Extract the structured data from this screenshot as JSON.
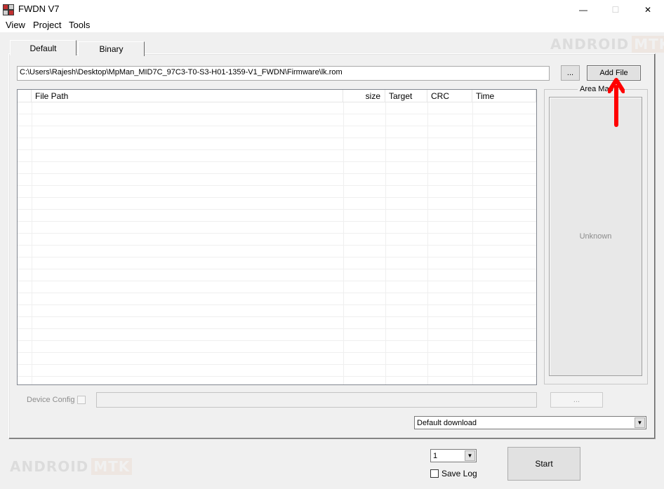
{
  "window": {
    "title": "FWDN V7",
    "controls": {
      "minimize": "—",
      "maximize": "☐",
      "close": "✕"
    }
  },
  "menu": [
    "View",
    "Project",
    "Tools"
  ],
  "tabs": [
    {
      "label": "Default",
      "active": true
    },
    {
      "label": "Binary",
      "active": false
    }
  ],
  "path_input": {
    "value": "C:\\Users\\Rajesh\\Desktop\\MpMan_MID7C_97C3-T0-S3-H01-1359-V1_FWDN\\Firmware\\lk.rom"
  },
  "buttons": {
    "browse": "...",
    "add_file": "Add File",
    "device_config_browse": "...",
    "start": "Start"
  },
  "file_table": {
    "columns": [
      "",
      "File Path",
      "size",
      "Target",
      "CRC",
      "Time"
    ],
    "rows": []
  },
  "area_map": {
    "label": "Area Map",
    "status": "Unknown"
  },
  "device_config": {
    "label": "Device Config",
    "checked": false,
    "enabled": false
  },
  "download_mode": {
    "selected": "Default download"
  },
  "count_select": {
    "selected": "1"
  },
  "save_log": {
    "label": "Save Log",
    "checked": false
  },
  "watermark": {
    "word1": "ANDROID",
    "word2": "MTK"
  },
  "colors": {
    "annotation_arrow": "#ff0000",
    "watermark_accent": "#e08040"
  }
}
